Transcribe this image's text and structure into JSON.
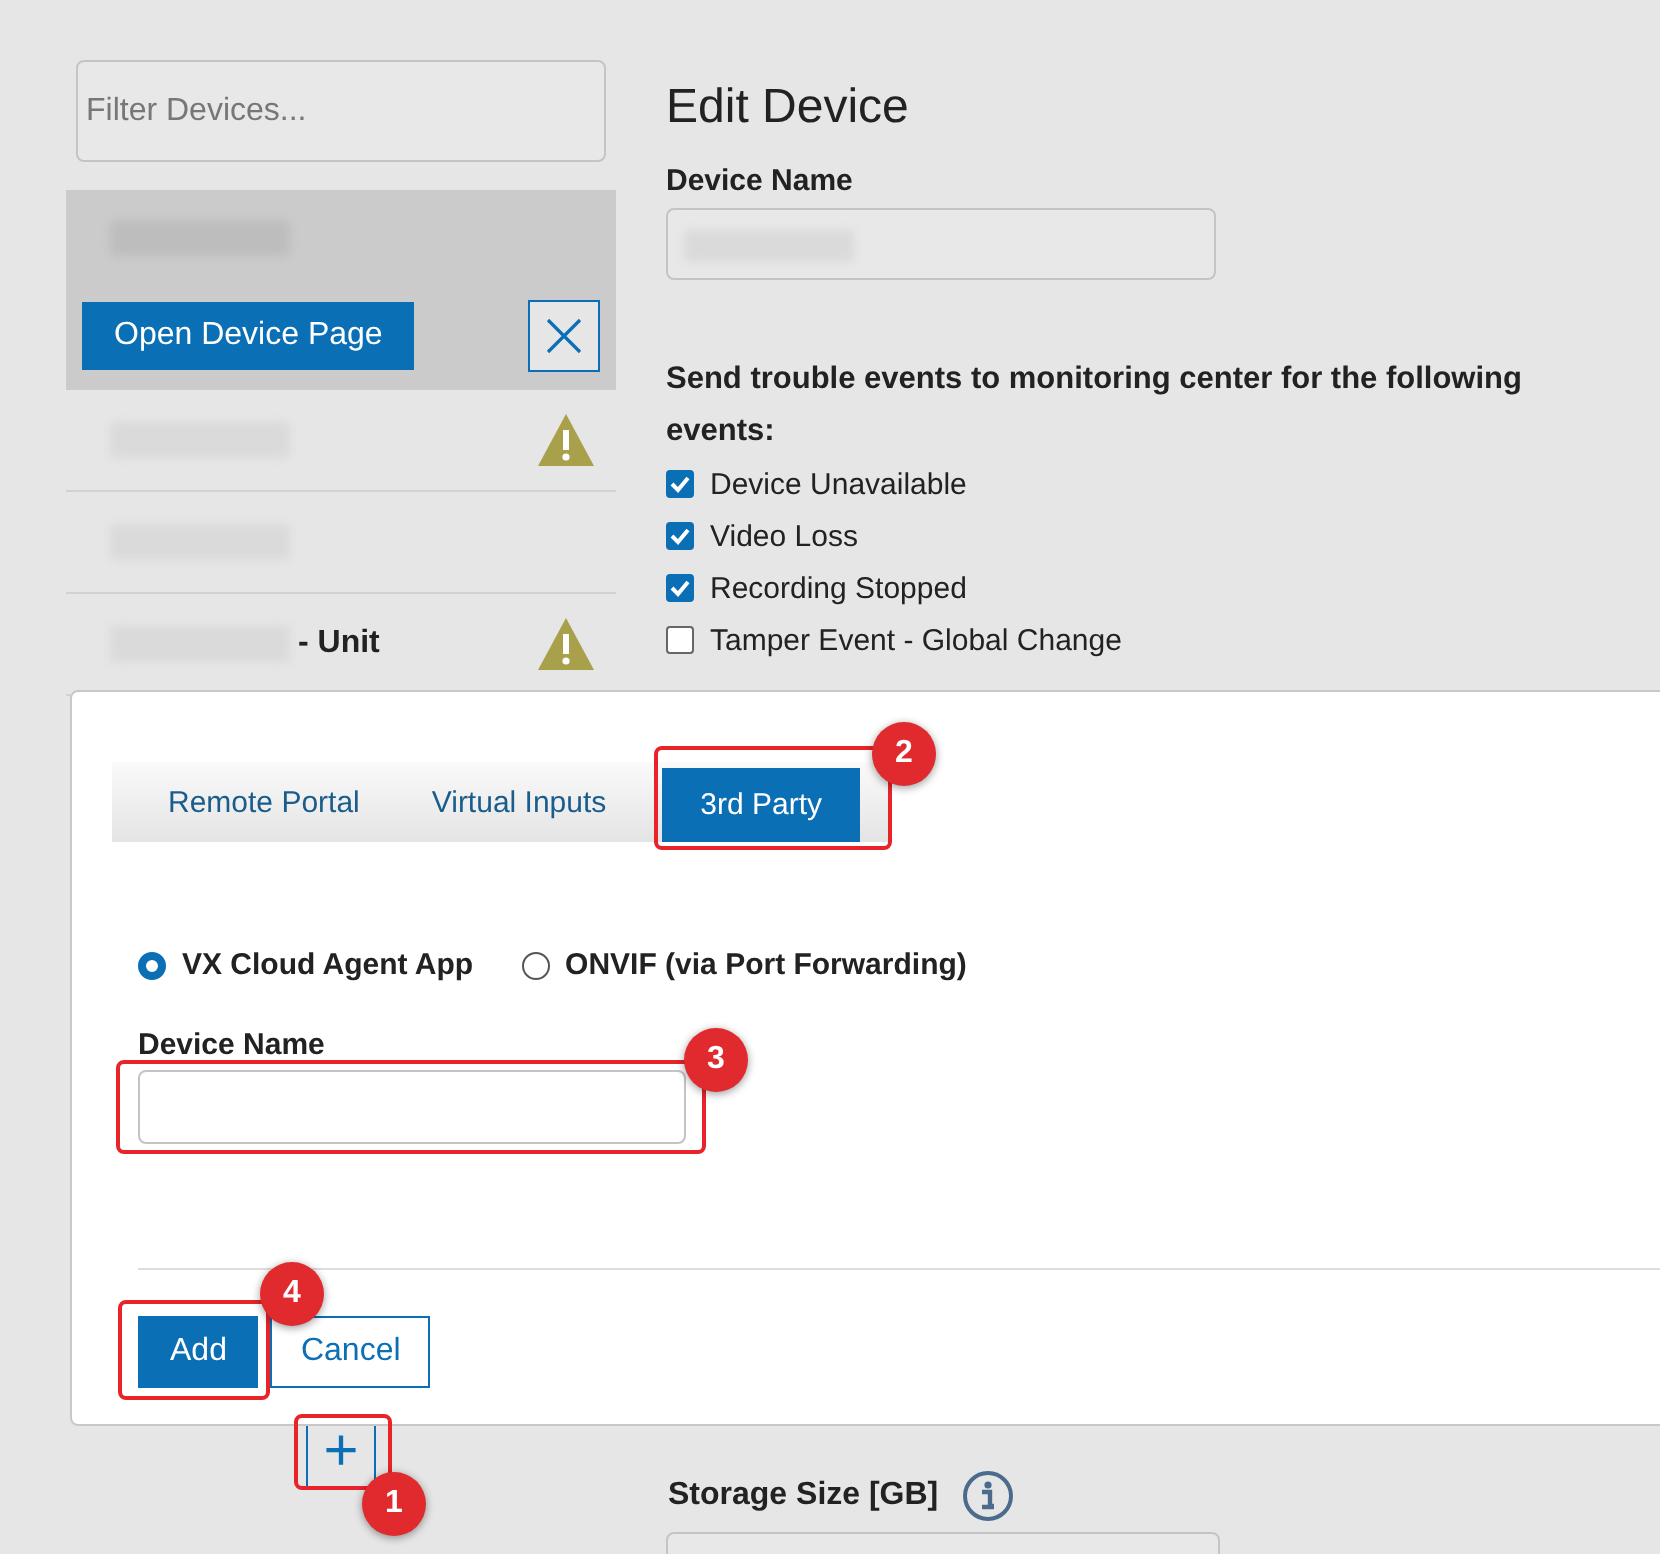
{
  "sidebar": {
    "filter": {
      "placeholder": "Filter Devices..."
    },
    "items": [
      {
        "selected": true,
        "warning": false,
        "open_button": "Open Device Page"
      },
      {
        "selected": false,
        "warning": true
      },
      {
        "selected": false,
        "warning": false
      },
      {
        "label": "- Unit",
        "selected": false,
        "warning": true
      }
    ],
    "add_button": "+"
  },
  "editor": {
    "title": "Edit Device",
    "name_label": "Device Name",
    "events_heading": "Send trouble events to monitoring center for the following events:",
    "events": [
      {
        "label": "Device Unavailable",
        "checked": true
      },
      {
        "label": "Video Loss",
        "checked": true
      },
      {
        "label": "Recording Stopped",
        "checked": true
      },
      {
        "label": "Tamper Event - Global Change",
        "checked": false
      }
    ],
    "storage_label": "Storage Size [GB]"
  },
  "dialog": {
    "tabs": [
      {
        "label": "Remote Portal",
        "selected": false
      },
      {
        "label": "Virtual Inputs",
        "selected": false
      },
      {
        "label": "3rd Party",
        "selected": true
      }
    ],
    "options": [
      {
        "label": "VX Cloud Agent App",
        "selected": true
      },
      {
        "label": "ONVIF (via Port Forwarding)",
        "selected": false
      }
    ],
    "name_label": "Device Name",
    "buttons": [
      {
        "label": "Add",
        "kind": "primary"
      },
      {
        "label": "Cancel",
        "kind": "secondary"
      }
    ]
  },
  "callouts": [
    {
      "number": "1"
    },
    {
      "number": "2"
    },
    {
      "number": "3"
    },
    {
      "number": "4"
    }
  ]
}
